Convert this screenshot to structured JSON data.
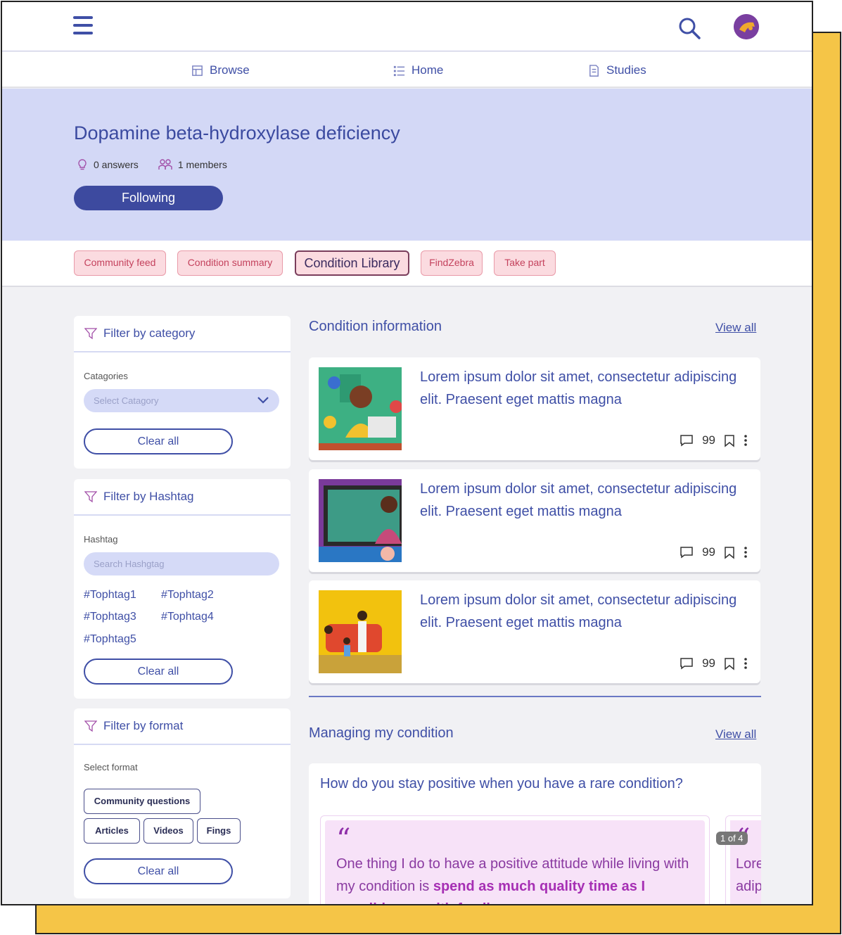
{
  "header": {
    "menu_icon": "hamburger-icon",
    "search_icon": "search-icon",
    "avatar_icon": "avatar"
  },
  "nav": {
    "browse": "Browse",
    "home": "Home",
    "studies": "Studies"
  },
  "hero": {
    "title": "Dopamine beta-hydroxylase deficiency",
    "answers": "0 answers",
    "members": "1 members",
    "follow_label": "Following"
  },
  "tabs": [
    {
      "label": "Community feed"
    },
    {
      "label": "Condition summary"
    },
    {
      "label": "Condition Library"
    },
    {
      "label": "FindZebra"
    },
    {
      "label": "Take part"
    }
  ],
  "filters": {
    "category": {
      "title": "Filter by category",
      "label": "Catagories",
      "placeholder": "Select Catagory",
      "clear": "Clear all"
    },
    "hashtag": {
      "title": "Filter by Hashtag",
      "label": "Hashtag",
      "placeholder": "Search Hashgtag",
      "tags": [
        "#Tophtag1",
        "#Tophtag2",
        "#Tophtag3",
        "#Tophtag4",
        "#Tophtag5"
      ],
      "clear": "Clear all"
    },
    "format": {
      "title": "Filter by format",
      "label": "Select format",
      "options": [
        "Community questions",
        "Articles",
        "Videos",
        "Fings"
      ],
      "clear": "Clear all"
    }
  },
  "condition_info": {
    "title": "Condition information",
    "view_all": "View all",
    "cards": [
      {
        "text": "Lorem ipsum dolor sit amet, consectetur adipiscing elit. Praesent eget mattis magna",
        "comments": "99"
      },
      {
        "text": "Lorem ipsum dolor sit amet, consectetur adipiscing elit. Praesent eget mattis magna",
        "comments": "99"
      },
      {
        "text": "Lorem ipsum dolor sit amet, consectetur adipiscing elit. Praesent eget mattis magna",
        "comments": "99"
      }
    ]
  },
  "managing": {
    "title": "Managing my condition",
    "view_all": "View all",
    "question": "How do you stay positive when you have a rare condition?",
    "quote_prefix": "One thing I do to have a positive attitude while living with my condition is ",
    "quote_highlight": "spend as much quality time as I possibly can with family",
    "pager": "1 of 4",
    "next_preview": "Lorem adipi"
  },
  "colors": {
    "primary": "#3f4fa6",
    "hero_bg": "#d3d8f6",
    "tab_bg": "#fbdbe0",
    "accent_shadow": "#f5c547",
    "quote_bg": "#f7e2f8"
  }
}
